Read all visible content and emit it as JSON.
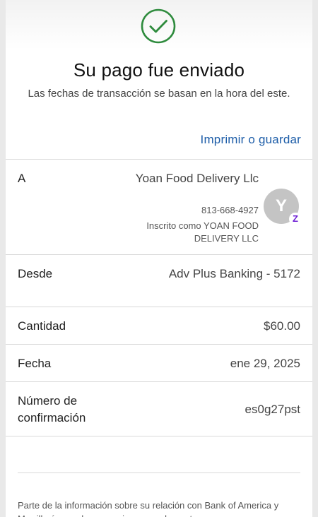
{
  "header": {
    "status_icon": "check-circle-icon",
    "accent_color": "#2e8b3d",
    "title": "Su pago fue enviado",
    "subtitle": "Las fechas de transacción se basan en la hora del este.",
    "print_link": "Imprimir o guardar",
    "link_color": "#1d5da8"
  },
  "recipient": {
    "label": "A",
    "name": "Yoan Food Delivery Llc",
    "phone": "813-668-4927",
    "registered_as": "Inscrito como YOAN FOOD DELIVERY LLC",
    "avatar_initial": "Y",
    "badge": "Z",
    "badge_color": "#6d1ed4"
  },
  "details": {
    "from_label": "Desde",
    "from_value": "Adv Plus Banking - 5172",
    "amount_label": "Cantidad",
    "amount_value": "$60.00",
    "date_label": "Fecha",
    "date_value": "ene 29, 2025",
    "confirmation_label": "Número de confirmación",
    "confirmation_value": "es0g27pst"
  },
  "footer": {
    "disclaimer": "Parte de la información sobre su relación con Bank of America y Merrill aún puede proporcionarse solamente en"
  }
}
